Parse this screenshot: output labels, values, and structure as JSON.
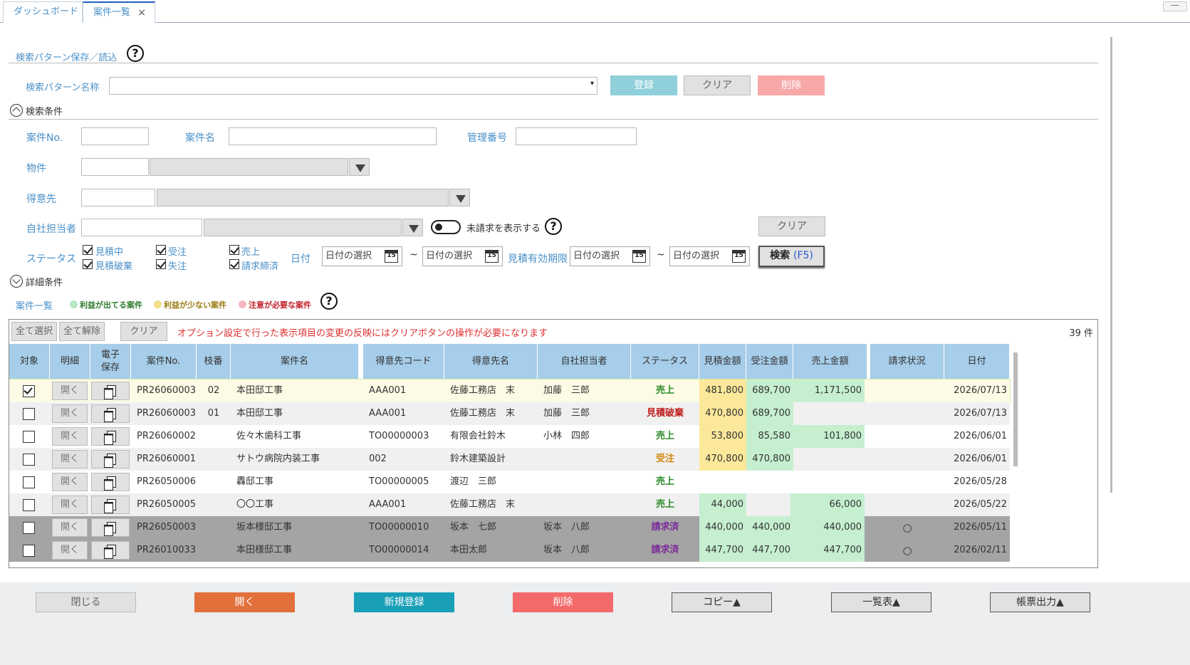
{
  "tabs": [
    {
      "label": "ダッシュボード"
    },
    {
      "label": "案件一覧",
      "close": "×"
    }
  ],
  "window": {
    "minimize": "—"
  },
  "pattern": {
    "section_title": "検索パターン保存／読込",
    "name_label": "検索パターン名称",
    "name_value": "",
    "dropdown_caret": "▾",
    "register": "登録",
    "clear": "クリア",
    "delete": "削除"
  },
  "help_glyph": "?",
  "search": {
    "section_title": "検索条件",
    "case_no_label": "案件No.",
    "case_name_label": "案件名",
    "mgmt_no_label": "管理番号",
    "property_label": "物件",
    "customer_label": "得意先",
    "staff_label": "自社担当者",
    "unbilled_label": "未請求を表示する",
    "clear": "クリア",
    "status_label": "ステータス",
    "statuses": [
      {
        "label": "見積中",
        "checked": true
      },
      {
        "label": "受注",
        "checked": true
      },
      {
        "label": "売上",
        "checked": true
      },
      {
        "label": "見積破棄",
        "checked": true
      },
      {
        "label": "失注",
        "checked": true
      },
      {
        "label": "請求締済",
        "checked": true
      }
    ],
    "date_label": "日付",
    "date_placeholder": "日付の選択",
    "tilde": "~",
    "estimate_expiry_label": "見積有効期限",
    "calendar_num": "15",
    "search_button": "検索",
    "search_key": "(F5)",
    "detail_section": "詳細条件"
  },
  "list": {
    "title": "案件一覧",
    "legend": [
      {
        "label": "利益が出てる案件",
        "color": "#b6e6c2",
        "text_color": "#2a7a2a"
      },
      {
        "label": "利益が少ない案件",
        "color": "#f5df8a",
        "text_color": "#9a7a10"
      },
      {
        "label": "注意が必要な案件",
        "color": "#f5b6c0",
        "text_color": "#c0202a"
      }
    ],
    "select_all": "全て選択",
    "deselect_all": "全て解除",
    "clear": "クリア",
    "notice": "オプション設定で行った表示項目の変更の反映にはクリアボタンの操作が必要になります",
    "count": "39 件"
  },
  "columns": [
    "対象",
    "明細",
    "電子\n保存",
    "案件No.",
    "枝番",
    "案件名",
    "得意先コード",
    "得意先名",
    "自社担当者",
    "ステータス",
    "見積金額",
    "受注金額",
    "売上金額",
    "請求状況",
    "日付"
  ],
  "open_label": "開く",
  "rows": [
    {
      "checked": true,
      "no": "PR26060003",
      "branch": "02",
      "name": "本田邸工事",
      "code": "AAA001",
      "customer": "佐藤工務店　末",
      "staff": "加藤　三郎",
      "status": "売上",
      "status_color": "#2a8a2a",
      "est": "481,800",
      "est_bg": "#fbe89a",
      "ord": "689,700",
      "ord_bg": "#c5efcf",
      "sales": "1,171,500",
      "sales_bg": "#c5efcf",
      "billing": "",
      "date": "2026/07/13",
      "row_bg": "#fdfbe6",
      "selected": true
    },
    {
      "checked": false,
      "no": "PR26060003",
      "branch": "01",
      "name": "本田邸工事",
      "code": "AAA001",
      "customer": "佐藤工務店　末",
      "staff": "加藤　三郎",
      "status": "見積破棄",
      "status_color": "#c02020",
      "est": "470,800",
      "est_bg": "#fbe89a",
      "ord": "689,700",
      "ord_bg": "#c5efcf",
      "sales": "",
      "sales_bg": "",
      "billing": "",
      "date": "2026/07/13",
      "row_bg": "#f0f0f0"
    },
    {
      "checked": false,
      "no": "PR26060002",
      "branch": "",
      "name": "佐々木歯科工事",
      "code": "TO00000003",
      "customer": "有限会社鈴木",
      "staff": "小林　四郎",
      "status": "売上",
      "status_color": "#2a8a2a",
      "est": "53,800",
      "est_bg": "#fbe89a",
      "ord": "85,580",
      "ord_bg": "#c5efcf",
      "sales": "101,800",
      "sales_bg": "#c5efcf",
      "billing": "",
      "date": "2026/06/01",
      "row_bg": "#ffffff"
    },
    {
      "checked": false,
      "no": "PR26060001",
      "branch": "",
      "name": "サトウ病院内装工事",
      "code": "002",
      "customer": "鈴木建築設計",
      "staff": "",
      "status": "受注",
      "status_color": "#d08a10",
      "est": "470,800",
      "est_bg": "#fbe89a",
      "ord": "470,800",
      "ord_bg": "#c5efcf",
      "sales": "",
      "sales_bg": "",
      "billing": "",
      "date": "2026/06/01",
      "row_bg": "#f0f0f0"
    },
    {
      "checked": false,
      "no": "PR26050006",
      "branch": "",
      "name": "轟邸工事",
      "code": "TO00000005",
      "customer": "渡辺　三郎",
      "staff": "",
      "status": "売上",
      "status_color": "#2a8a2a",
      "est": "",
      "est_bg": "",
      "ord": "",
      "ord_bg": "",
      "sales": "",
      "sales_bg": "",
      "billing": "",
      "date": "2026/05/28",
      "row_bg": "#ffffff"
    },
    {
      "checked": false,
      "no": "PR26050005",
      "branch": "",
      "name": "〇〇工事",
      "code": "AAA001",
      "customer": "佐藤工務店　末",
      "staff": "",
      "status": "売上",
      "status_color": "#2a8a2a",
      "est": "44,000",
      "est_bg": "#c5efcf",
      "ord": "",
      "ord_bg": "",
      "sales": "66,000",
      "sales_bg": "#c5efcf",
      "billing": "",
      "date": "2026/05/22",
      "row_bg": "#f0f0f0"
    },
    {
      "checked": false,
      "no": "PR26050003",
      "branch": "",
      "name": "坂本様邸工事",
      "code": "TO00000010",
      "customer": "坂本　七郎",
      "staff": "坂本　八郎",
      "status": "請求済",
      "status_color": "#7a2a9a",
      "est": "440,000",
      "est_bg": "#c5efcf",
      "ord": "440,000",
      "ord_bg": "#c5efcf",
      "sales": "440,000",
      "sales_bg": "#c5efcf",
      "billing": "○",
      "date": "2026/05/11",
      "row_bg": "#a4a4a4"
    },
    {
      "checked": false,
      "no": "PR26010033",
      "branch": "",
      "name": "本田様邸工事",
      "code": "TO00000014",
      "customer": "本田太郎",
      "staff": "坂本　八郎",
      "status": "請求済",
      "status_color": "#7a2a9a",
      "est": "447,700",
      "est_bg": "#c5efcf",
      "ord": "447,700",
      "ord_bg": "#c5efcf",
      "sales": "447,700",
      "sales_bg": "#c5efcf",
      "billing": "○",
      "date": "2026/02/11",
      "row_bg": "#a4a4a4"
    }
  ],
  "footer": {
    "close": "閉じる",
    "open": "開く",
    "new": "新規登録",
    "delete": "削除",
    "copy": "コピー▲",
    "list": "一覧表▲",
    "report": "帳票出力▲"
  },
  "colors": {
    "accent_blue": "#4a90c8",
    "open_button": "#e2703a",
    "new_button": "#1a9fb8",
    "delete_button": "#f46a6a",
    "register_button": "#8fd0da",
    "header_blue": "#a6cde9"
  }
}
